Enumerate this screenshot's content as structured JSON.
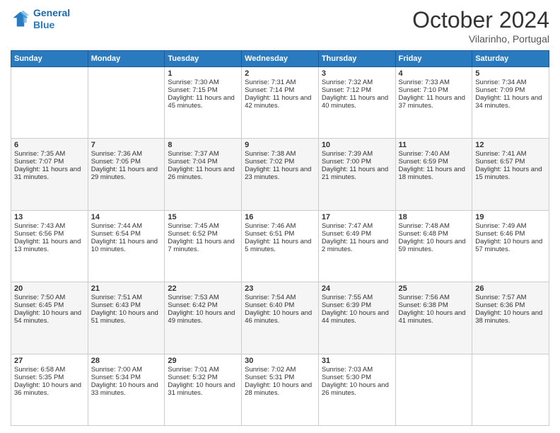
{
  "logo": {
    "line1": "General",
    "line2": "Blue"
  },
  "header": {
    "month": "October 2024",
    "location": "Vilarinho, Portugal"
  },
  "days_of_week": [
    "Sunday",
    "Monday",
    "Tuesday",
    "Wednesday",
    "Thursday",
    "Friday",
    "Saturday"
  ],
  "weeks": [
    [
      {
        "day": "",
        "sunrise": "",
        "sunset": "",
        "daylight": ""
      },
      {
        "day": "",
        "sunrise": "",
        "sunset": "",
        "daylight": ""
      },
      {
        "day": "1",
        "sunrise": "Sunrise: 7:30 AM",
        "sunset": "Sunset: 7:15 PM",
        "daylight": "Daylight: 11 hours and 45 minutes."
      },
      {
        "day": "2",
        "sunrise": "Sunrise: 7:31 AM",
        "sunset": "Sunset: 7:14 PM",
        "daylight": "Daylight: 11 hours and 42 minutes."
      },
      {
        "day": "3",
        "sunrise": "Sunrise: 7:32 AM",
        "sunset": "Sunset: 7:12 PM",
        "daylight": "Daylight: 11 hours and 40 minutes."
      },
      {
        "day": "4",
        "sunrise": "Sunrise: 7:33 AM",
        "sunset": "Sunset: 7:10 PM",
        "daylight": "Daylight: 11 hours and 37 minutes."
      },
      {
        "day": "5",
        "sunrise": "Sunrise: 7:34 AM",
        "sunset": "Sunset: 7:09 PM",
        "daylight": "Daylight: 11 hours and 34 minutes."
      }
    ],
    [
      {
        "day": "6",
        "sunrise": "Sunrise: 7:35 AM",
        "sunset": "Sunset: 7:07 PM",
        "daylight": "Daylight: 11 hours and 31 minutes."
      },
      {
        "day": "7",
        "sunrise": "Sunrise: 7:36 AM",
        "sunset": "Sunset: 7:05 PM",
        "daylight": "Daylight: 11 hours and 29 minutes."
      },
      {
        "day": "8",
        "sunrise": "Sunrise: 7:37 AM",
        "sunset": "Sunset: 7:04 PM",
        "daylight": "Daylight: 11 hours and 26 minutes."
      },
      {
        "day": "9",
        "sunrise": "Sunrise: 7:38 AM",
        "sunset": "Sunset: 7:02 PM",
        "daylight": "Daylight: 11 hours and 23 minutes."
      },
      {
        "day": "10",
        "sunrise": "Sunrise: 7:39 AM",
        "sunset": "Sunset: 7:00 PM",
        "daylight": "Daylight: 11 hours and 21 minutes."
      },
      {
        "day": "11",
        "sunrise": "Sunrise: 7:40 AM",
        "sunset": "Sunset: 6:59 PM",
        "daylight": "Daylight: 11 hours and 18 minutes."
      },
      {
        "day": "12",
        "sunrise": "Sunrise: 7:41 AM",
        "sunset": "Sunset: 6:57 PM",
        "daylight": "Daylight: 11 hours and 15 minutes."
      }
    ],
    [
      {
        "day": "13",
        "sunrise": "Sunrise: 7:43 AM",
        "sunset": "Sunset: 6:56 PM",
        "daylight": "Daylight: 11 hours and 13 minutes."
      },
      {
        "day": "14",
        "sunrise": "Sunrise: 7:44 AM",
        "sunset": "Sunset: 6:54 PM",
        "daylight": "Daylight: 11 hours and 10 minutes."
      },
      {
        "day": "15",
        "sunrise": "Sunrise: 7:45 AM",
        "sunset": "Sunset: 6:52 PM",
        "daylight": "Daylight: 11 hours and 7 minutes."
      },
      {
        "day": "16",
        "sunrise": "Sunrise: 7:46 AM",
        "sunset": "Sunset: 6:51 PM",
        "daylight": "Daylight: 11 hours and 5 minutes."
      },
      {
        "day": "17",
        "sunrise": "Sunrise: 7:47 AM",
        "sunset": "Sunset: 6:49 PM",
        "daylight": "Daylight: 11 hours and 2 minutes."
      },
      {
        "day": "18",
        "sunrise": "Sunrise: 7:48 AM",
        "sunset": "Sunset: 6:48 PM",
        "daylight": "Daylight: 10 hours and 59 minutes."
      },
      {
        "day": "19",
        "sunrise": "Sunrise: 7:49 AM",
        "sunset": "Sunset: 6:46 PM",
        "daylight": "Daylight: 10 hours and 57 minutes."
      }
    ],
    [
      {
        "day": "20",
        "sunrise": "Sunrise: 7:50 AM",
        "sunset": "Sunset: 6:45 PM",
        "daylight": "Daylight: 10 hours and 54 minutes."
      },
      {
        "day": "21",
        "sunrise": "Sunrise: 7:51 AM",
        "sunset": "Sunset: 6:43 PM",
        "daylight": "Daylight: 10 hours and 51 minutes."
      },
      {
        "day": "22",
        "sunrise": "Sunrise: 7:53 AM",
        "sunset": "Sunset: 6:42 PM",
        "daylight": "Daylight: 10 hours and 49 minutes."
      },
      {
        "day": "23",
        "sunrise": "Sunrise: 7:54 AM",
        "sunset": "Sunset: 6:40 PM",
        "daylight": "Daylight: 10 hours and 46 minutes."
      },
      {
        "day": "24",
        "sunrise": "Sunrise: 7:55 AM",
        "sunset": "Sunset: 6:39 PM",
        "daylight": "Daylight: 10 hours and 44 minutes."
      },
      {
        "day": "25",
        "sunrise": "Sunrise: 7:56 AM",
        "sunset": "Sunset: 6:38 PM",
        "daylight": "Daylight: 10 hours and 41 minutes."
      },
      {
        "day": "26",
        "sunrise": "Sunrise: 7:57 AM",
        "sunset": "Sunset: 6:36 PM",
        "daylight": "Daylight: 10 hours and 38 minutes."
      }
    ],
    [
      {
        "day": "27",
        "sunrise": "Sunrise: 6:58 AM",
        "sunset": "Sunset: 5:35 PM",
        "daylight": "Daylight: 10 hours and 36 minutes."
      },
      {
        "day": "28",
        "sunrise": "Sunrise: 7:00 AM",
        "sunset": "Sunset: 5:34 PM",
        "daylight": "Daylight: 10 hours and 33 minutes."
      },
      {
        "day": "29",
        "sunrise": "Sunrise: 7:01 AM",
        "sunset": "Sunset: 5:32 PM",
        "daylight": "Daylight: 10 hours and 31 minutes."
      },
      {
        "day": "30",
        "sunrise": "Sunrise: 7:02 AM",
        "sunset": "Sunset: 5:31 PM",
        "daylight": "Daylight: 10 hours and 28 minutes."
      },
      {
        "day": "31",
        "sunrise": "Sunrise: 7:03 AM",
        "sunset": "Sunset: 5:30 PM",
        "daylight": "Daylight: 10 hours and 26 minutes."
      },
      {
        "day": "",
        "sunrise": "",
        "sunset": "",
        "daylight": ""
      },
      {
        "day": "",
        "sunrise": "",
        "sunset": "",
        "daylight": ""
      }
    ]
  ]
}
